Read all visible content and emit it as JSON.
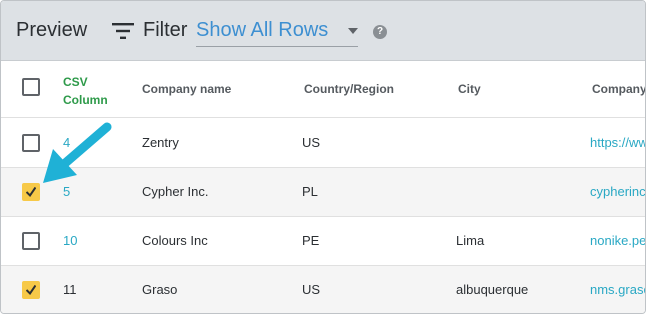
{
  "toolbar": {
    "title": "Preview",
    "filter_label": "Filter",
    "filter_value": "Show All Rows",
    "help_glyph": "?"
  },
  "table": {
    "columns": [
      "CSV Column",
      "Company name",
      "Country/Region",
      "City",
      "Company"
    ],
    "rows": [
      {
        "checked": false,
        "index": "4",
        "company": "Zentry",
        "country": "US",
        "city": "",
        "url": "https://ww"
      },
      {
        "checked": true,
        "index": "5",
        "company": "Cypher Inc.",
        "country": "PL",
        "city": "",
        "url": "cypherinc"
      },
      {
        "checked": false,
        "index": "10",
        "company": "Colours Inc",
        "country": "PE",
        "city": "Lima",
        "url": "nonike.pe"
      },
      {
        "checked": true,
        "index": "11",
        "company": "Graso",
        "country": "US",
        "city": "albuquerque",
        "url": "nms.graso"
      }
    ]
  },
  "colors": {
    "accent_blue": "#3d8fd1",
    "link_teal": "#29a8c4",
    "csv_green": "#2e9a4a",
    "checked_yellow": "#f7c948",
    "toolbar_bg": "#dde1e5",
    "arrow_cyan": "#1fb1d6"
  },
  "icons": [
    "filter-icon",
    "chevron-down-icon",
    "help-icon",
    "check-icon",
    "pointer-arrow-icon"
  ]
}
